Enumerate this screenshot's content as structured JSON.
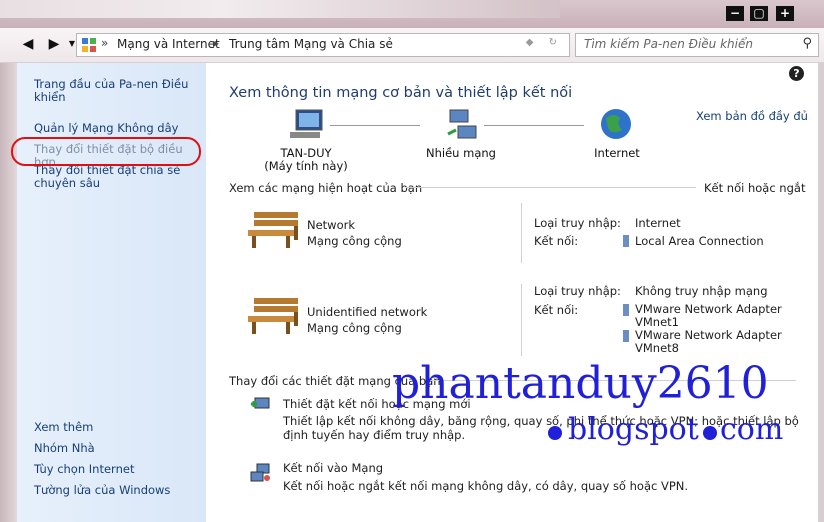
{
  "window": {
    "controls": [
      "−",
      "▢",
      "+"
    ]
  },
  "toolbar": {
    "breadcrumb": [
      "Mạng và Internet",
      "Trung tâm Mạng và Chia sẻ"
    ],
    "search_placeholder": "Tìm kiếm Pa-nen Điều khiển"
  },
  "sidebar": {
    "home": "Trang đầu của Pa-nen Điều khiển",
    "links": [
      "Quản lý Mạng Không dây",
      "Thay đổi thiết đặt bộ điều hợp",
      "Thay đổi thiết đặt chia sẻ chuyên sâu"
    ],
    "see_also": [
      "Xem thêm",
      "Nhóm Nhà",
      "Tùy chọn Internet",
      "Tường lửa của Windows"
    ]
  },
  "main": {
    "title": "Xem thông tin mạng cơ bản và thiết lập kết nối",
    "full_map": "Xem bản đồ đầy đủ",
    "nodes": [
      {
        "name": "TAN-DUY",
        "sub": "(Máy tính này)",
        "icon": "computer-icon"
      },
      {
        "name": "Nhiều mạng",
        "icon": "network-icon"
      },
      {
        "name": "Internet",
        "icon": "globe-icon"
      }
    ],
    "active_header": "Xem các mạng hiện hoạt của bạn",
    "connect_link": "Kết nối hoặc ngắt",
    "networks": [
      {
        "name": "Network",
        "type": "Mạng công cộng",
        "access_label": "Loại truy nhập:",
        "access_value": "Internet",
        "conn_label": "Kết nối:",
        "connections": [
          "Local Area Connection"
        ]
      },
      {
        "name": "Unidentified network",
        "type": "Mạng công cộng",
        "access_label": "Loại truy nhập:",
        "access_value": "Không truy nhập mạng",
        "conn_label": "Kết nối:",
        "connections": [
          "VMware Network Adapter\nVMnet1",
          "VMware Network Adapter\nVMnet8"
        ]
      }
    ],
    "change_header": "Thay đổi các thiết đặt mạng của bạn",
    "tasks": [
      {
        "title": "Thiết đặt kết nối hoặc mạng mới",
        "desc": "Thiết lập kết nối không dây, băng rộng, quay số, phi thể thức hoặc VPN; hoặc thiết lập bộ định tuyến hay điểm truy nhập."
      },
      {
        "title": "Kết nối vào Mạng",
        "desc": "Kết nối hoặc ngắt kết nối mạng không dây, có dây, quay số hoặc VPN."
      }
    ]
  },
  "watermark": {
    "line1": "phantanduy2610",
    "line2a": "blogspot",
    "line2b": "com"
  },
  "colors": {
    "link": "#163f78",
    "sidebar": "#dde9f8",
    "highlight": "#d11111",
    "watermark": "#2020d8"
  }
}
